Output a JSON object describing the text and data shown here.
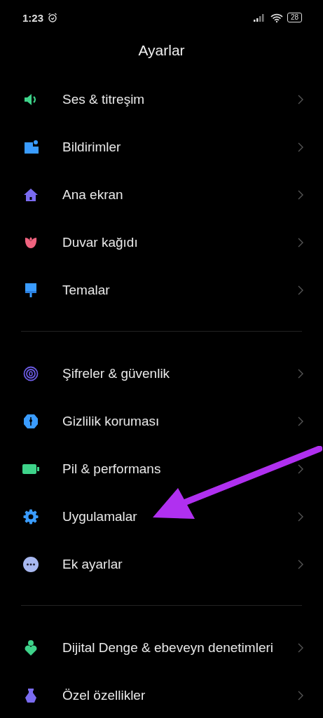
{
  "status_bar": {
    "time": "1:23",
    "battery": "28"
  },
  "title": "Ayarlar",
  "groups": [
    {
      "items": [
        {
          "label": "Ses & titreşim"
        },
        {
          "label": "Bildirimler"
        },
        {
          "label": "Ana ekran"
        },
        {
          "label": "Duvar kağıdı"
        },
        {
          "label": "Temalar"
        }
      ]
    },
    {
      "items": [
        {
          "label": "Şifreler & güvenlik"
        },
        {
          "label": "Gizlilik koruması"
        },
        {
          "label": "Pil & performans"
        },
        {
          "label": "Uygulamalar"
        },
        {
          "label": "Ek ayarlar"
        }
      ]
    },
    {
      "items": [
        {
          "label": "Dijital Denge & ebeveyn denetimleri"
        },
        {
          "label": "Özel özellikler"
        }
      ]
    }
  ]
}
